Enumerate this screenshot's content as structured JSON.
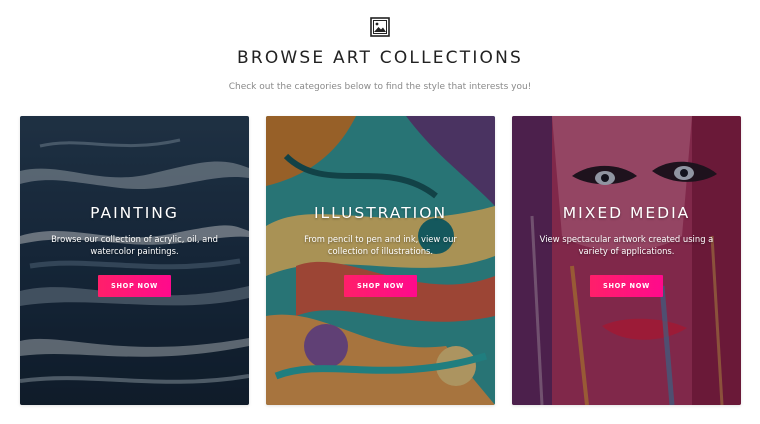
{
  "header": {
    "icon": "image-icon",
    "title": "BROWSE ART COLLECTIONS",
    "subtitle": "Check out the categories below to find the style that interests you!"
  },
  "cards": [
    {
      "title": "PAINTING",
      "description": "Browse our collection of acrylic, oil, and watercolor paintings.",
      "button_label": "SHOP NOW"
    },
    {
      "title": "ILLUSTRATION",
      "description": "From pencil to pen and ink, view our collection of illustrations.",
      "button_label": "SHOP NOW"
    },
    {
      "title": "MIXED MEDIA",
      "description": "View spectacular artwork created using a variety of applications.",
      "button_label": "SHOP NOW"
    }
  ],
  "colors": {
    "accent": "#ff1f6a",
    "title_text": "#222222",
    "subtitle_text": "#8a8a8a"
  }
}
